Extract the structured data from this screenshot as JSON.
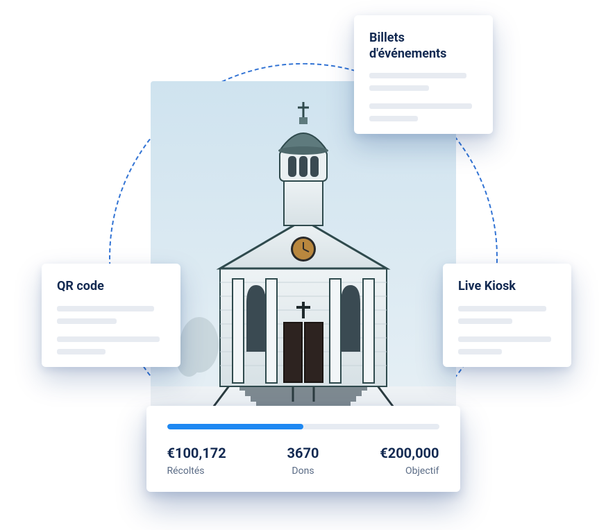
{
  "cards": {
    "top": {
      "title": "Billets d'événements"
    },
    "left": {
      "title": "QR code"
    },
    "right": {
      "title": "Live Kiosk"
    }
  },
  "stats": {
    "progress_percent": 50,
    "raised": {
      "value": "€100,172",
      "label": "Récoltés"
    },
    "donations": {
      "value": "3670",
      "label": "Dons"
    },
    "goal": {
      "value": "€200,000",
      "label": "Objectif"
    }
  }
}
